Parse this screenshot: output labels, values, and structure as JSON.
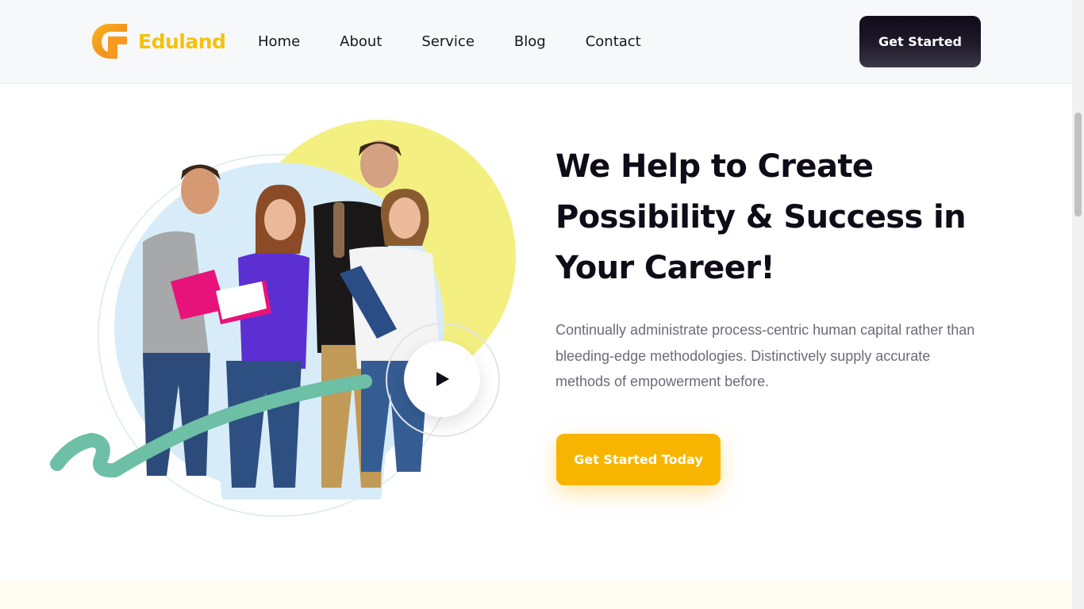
{
  "brand": {
    "name": "Eduland",
    "colors": {
      "logo_orange": "#f7931e",
      "logo_yellow": "#f5c10e"
    }
  },
  "nav": {
    "links": [
      "Home",
      "About",
      "Service",
      "Blog",
      "Contact"
    ],
    "cta_label": "Get Started"
  },
  "hero": {
    "title": "We Help to Create Possibility & Success in Your Career!",
    "description": "Continually administrate process-centric human capital rather than bleeding-edge methodologies. Distinctively supply accurate methods of empowerment before.",
    "cta_label": "Get Started Today",
    "play_icon": "play-icon",
    "colors": {
      "accent": "#f7b500",
      "title": "#0f0b17",
      "text": "#6e6a78",
      "brush": "#6dbfa6",
      "circle_yellow": "#f3f081",
      "circle_blue": "#d7ecf8"
    }
  }
}
